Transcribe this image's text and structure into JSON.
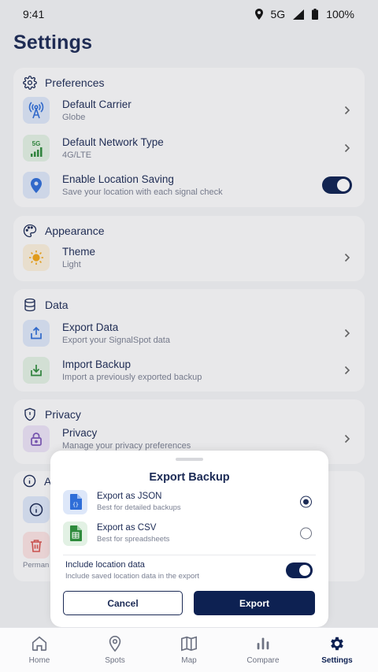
{
  "status_bar": {
    "time": "9:41",
    "network": "5G",
    "battery": "100%"
  },
  "page": {
    "title": "Settings"
  },
  "preferences": {
    "title": "Preferences",
    "items": [
      {
        "title": "Default Carrier",
        "subtitle": "Globe",
        "icon": "antenna-icon"
      },
      {
        "title": "Default Network Type",
        "subtitle": "4G/LTE",
        "icon": "5g-signal-icon",
        "badge": "5G"
      },
      {
        "title": "Enable Location Saving",
        "subtitle": "Save your location with each signal check",
        "icon": "location-pin-icon",
        "enabled": true
      }
    ]
  },
  "appearance": {
    "title": "Appearance",
    "items": [
      {
        "title": "Theme",
        "subtitle": "Light",
        "icon": "sun-icon"
      }
    ]
  },
  "data_section": {
    "title": "Data",
    "items": [
      {
        "title": "Export Data",
        "subtitle": "Export your SignalSpot data",
        "icon": "upload-icon"
      },
      {
        "title": "Import Backup",
        "subtitle": "Import a previously exported backup",
        "icon": "download-icon"
      }
    ]
  },
  "privacy": {
    "title": "Privacy",
    "items": [
      {
        "title": "Privacy",
        "subtitle": "Manage your privacy preferences",
        "icon": "lock-icon"
      }
    ]
  },
  "about_partial": {
    "title_fragment": "A",
    "permanent_fragment": "Perman"
  },
  "export_sheet": {
    "title": "Export Backup",
    "options": [
      {
        "title": "Export as JSON",
        "subtitle": "Best for detailed backups",
        "icon": "json-file-icon",
        "selected": true
      },
      {
        "title": "Export as CSV",
        "subtitle": "Best for spreadsheets",
        "icon": "csv-file-icon",
        "selected": false
      }
    ],
    "include_location": {
      "title": "Include location data",
      "subtitle": "Include saved location data in the export",
      "enabled": true
    },
    "cancel_label": "Cancel",
    "export_label": "Export"
  },
  "bottom_nav": {
    "items": [
      {
        "label": "Home",
        "icon": "home-icon"
      },
      {
        "label": "Spots",
        "icon": "map-pin-icon"
      },
      {
        "label": "Map",
        "icon": "map-icon"
      },
      {
        "label": "Compare",
        "icon": "bar-chart-icon"
      },
      {
        "label": "Settings",
        "icon": "gear-icon"
      }
    ],
    "active": "Settings"
  },
  "colors": {
    "primary": "#0d2152",
    "background": "#f2f3f5",
    "card": "#fbfbfc"
  }
}
